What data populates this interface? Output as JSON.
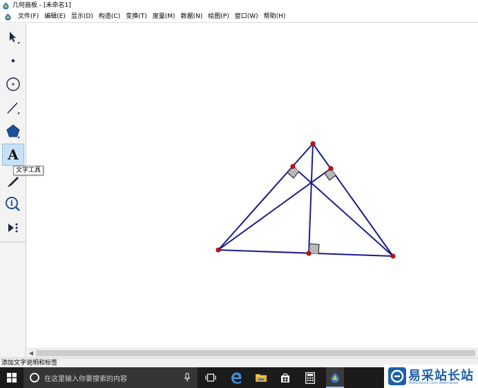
{
  "window": {
    "title": "几何画板 - [未命名1]"
  },
  "menubar": {
    "items": [
      "文件(F)",
      "编辑(E)",
      "显示(D)",
      "构造(C)",
      "变换(T)",
      "度量(M)",
      "数据(N)",
      "绘图(P)",
      "窗口(W)",
      "帮助(H)"
    ]
  },
  "toolbox": {
    "tools": [
      {
        "name": "move-arrow-tool",
        "selected": false
      },
      {
        "name": "point-tool",
        "selected": false
      },
      {
        "name": "compass-tool",
        "selected": false
      },
      {
        "name": "straightedge-tool",
        "selected": false
      },
      {
        "name": "polygon-tool",
        "selected": false
      },
      {
        "name": "text-tool",
        "label": "A",
        "selected": true
      },
      {
        "name": "marker-tool",
        "selected": false
      },
      {
        "name": "information-tool",
        "selected": false
      },
      {
        "name": "custom-tools",
        "selected": false
      }
    ],
    "tooltip": "文字工具"
  },
  "canvas": {
    "figure": "triangle-with-three-altitudes",
    "line_color": "#1a1a8c",
    "point_color": "#d01010",
    "right_angle_markers": 3
  },
  "statusbar": {
    "text": "添加文字说明和标签"
  },
  "taskbar": {
    "search_placeholder": "在这里输入你要搜索的内容",
    "icons": [
      "windows-start-icon",
      "cortana-icon",
      "microphone-icon",
      "task-view-icon",
      "edge-icon",
      "file-explorer-icon",
      "store-icon",
      "calculator-icon",
      "sketchpad-app-icon"
    ]
  },
  "watermark": {
    "text": "易采站长站",
    "subtext": "Www.Easck.Com  Webmaster"
  }
}
